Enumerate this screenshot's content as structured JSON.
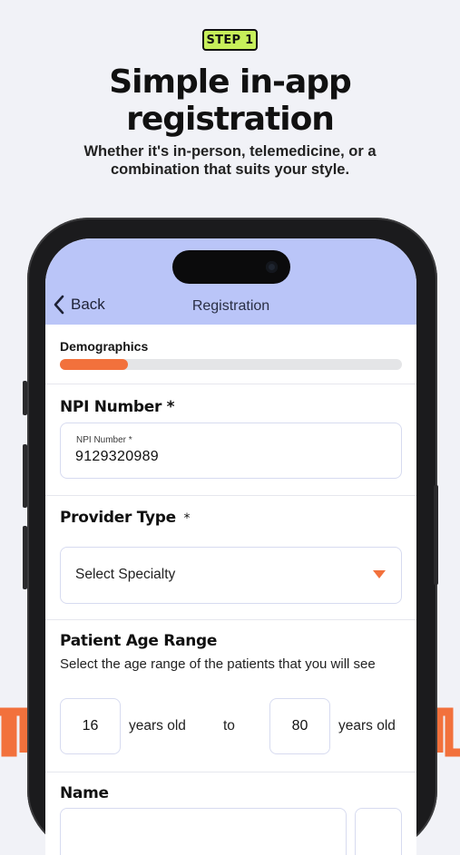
{
  "badge": {
    "label": "STEP 1"
  },
  "headline": {
    "line1": "Simple in-app",
    "line2": "registration"
  },
  "subheadline": {
    "line1": "Whether it's in-person, telemedicine, or a",
    "line2": "combination that suits your style."
  },
  "colors": {
    "accent": "#f2713c",
    "badge": "#c7ef5a",
    "header": "#bac5f8"
  },
  "nav": {
    "back_label": "Back",
    "title": "Registration",
    "back_icon": "chevron-left-icon"
  },
  "progress": {
    "label": "Demographics",
    "fraction": 0.2
  },
  "npi": {
    "title": "NPI Number *",
    "floating_label": "NPI Number *",
    "value": "9129320989"
  },
  "provider_type": {
    "title": "Provider Type",
    "required_mark": "*",
    "placeholder": "Select Specialty",
    "icon": "caret-down-icon"
  },
  "age_range": {
    "title": "Patient Age Range",
    "helper": "Select the age range of the patients that you will see",
    "min": "16",
    "min_unit": "years old",
    "separator": "to",
    "max": "80",
    "max_unit": "years old"
  },
  "name": {
    "title": "Name"
  }
}
